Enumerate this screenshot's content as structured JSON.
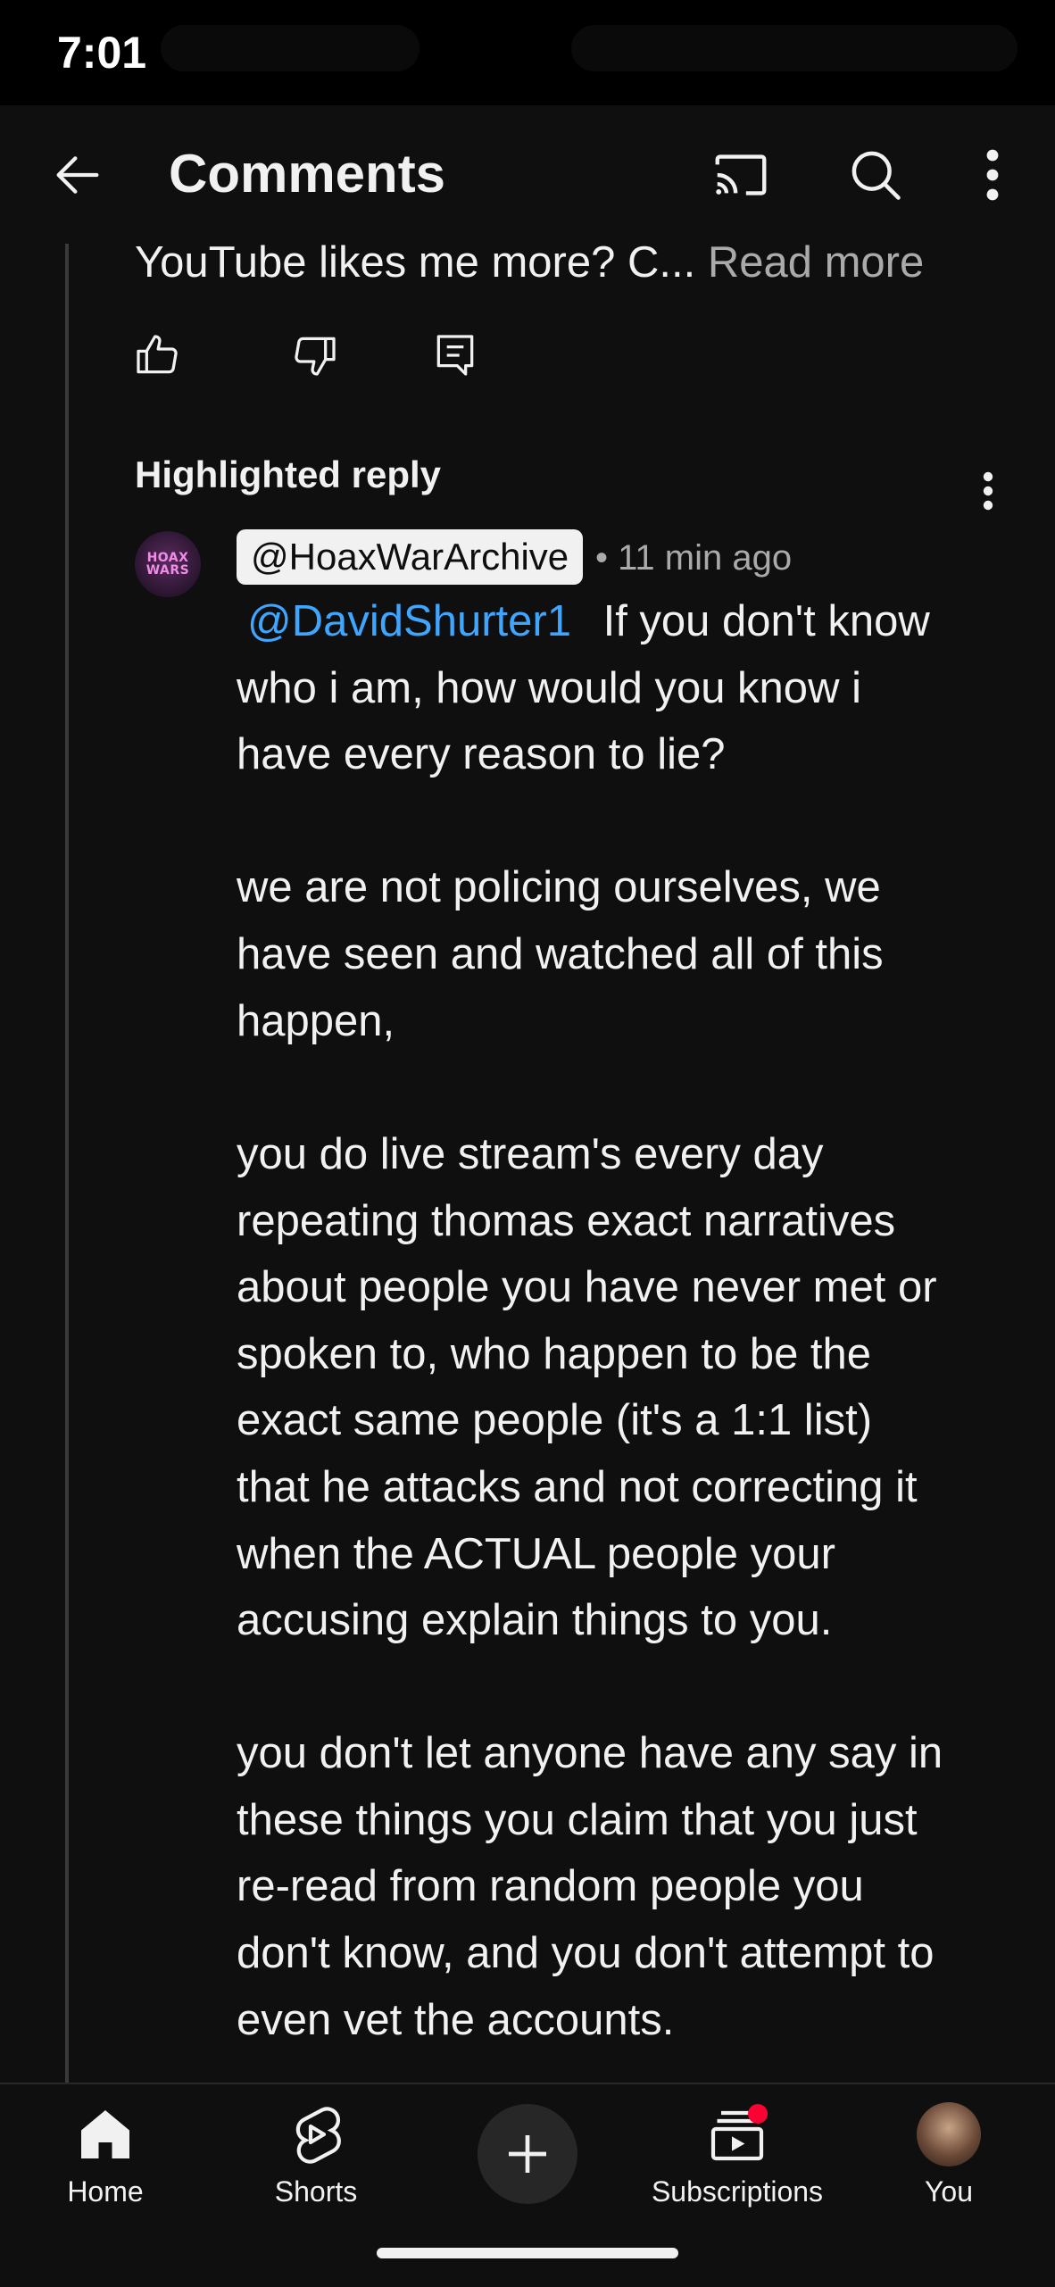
{
  "status_bar": {
    "time": "7:01"
  },
  "header": {
    "title": "Comments"
  },
  "parent_comment": {
    "text_tail": "YouTube likes me more? C...",
    "read_more": "Read more"
  },
  "highlighted": {
    "label": "Highlighted reply",
    "avatar_text": [
      "HOAX",
      "WARS"
    ],
    "handle": "@HoaxWarArchive",
    "time": "• 11 min ago",
    "mention": "@DavidShurter1",
    "lines": [
      "If you don't know",
      "who i am, how would you know i",
      "have every reason to lie?",
      "we are not policing ourselves, we",
      "have seen and watched all of this",
      "happen,",
      "you do live stream's every day",
      "repeating thomas exact narratives",
      "about people you have never met or",
      "spoken to, who happen to be the",
      "exact same people (it's a 1:1 list)",
      "that he attacks and not correcting it",
      "when the ACTUAL people your",
      "accusing explain things to you.",
      "you don't let anyone have any say in",
      "these things you claim that you just",
      "re-read from random people you",
      "don't know, and you don't attempt to",
      "even vet the accounts."
    ]
  },
  "bottom_nav": {
    "home": "Home",
    "shorts": "Shorts",
    "subscriptions": "Subscriptions",
    "you": "You"
  },
  "colors": {
    "background": "#0f0f0f",
    "mention": "#3ea6ff",
    "secondary_text": "#aaaaaa",
    "notification": "#ff0033"
  }
}
